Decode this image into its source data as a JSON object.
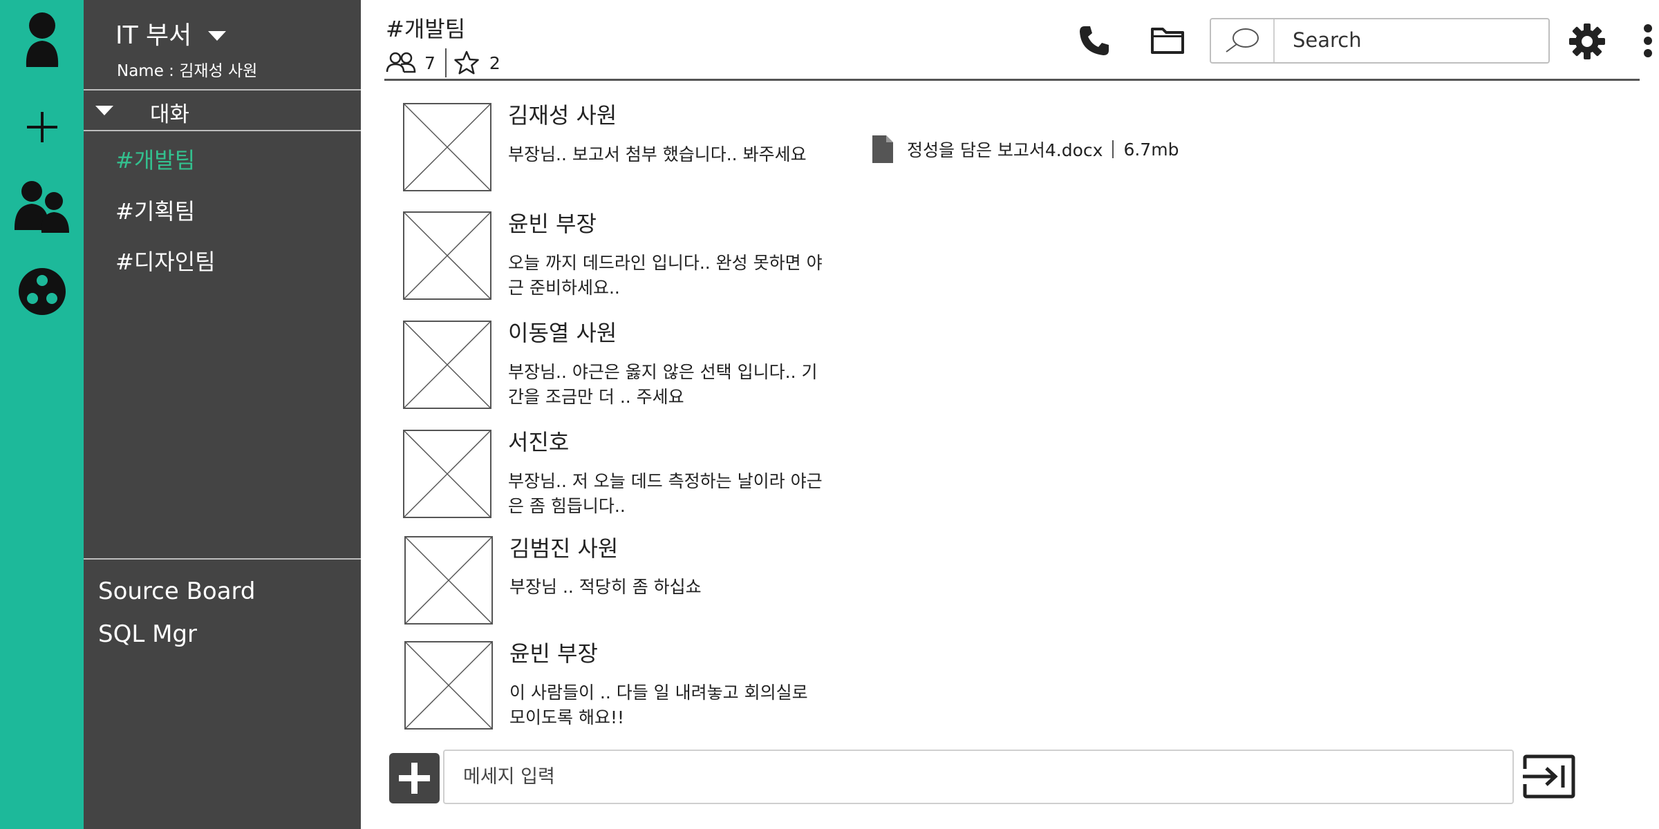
{
  "colors": {
    "rail": "#1db99a",
    "sidebar": "#444444",
    "active_channel": "#33c08e"
  },
  "rail": {
    "icons": [
      "profile-icon",
      "add-icon",
      "users-icon",
      "apps-icon"
    ]
  },
  "sidebar": {
    "workspace": "IT 부서",
    "user": "Name : 김재성 사원",
    "section": "대화",
    "channels": [
      "#개발팀",
      "#기획팀",
      "#디자인팀"
    ],
    "links": [
      "Source Board",
      "SQL Mgr"
    ]
  },
  "header": {
    "title": "#개발팀",
    "members": "7",
    "stars": "2",
    "search_placeholder": "Search",
    "icons": [
      "phone-icon",
      "folder-icon",
      "search-icon",
      "gear-icon",
      "more-icon"
    ]
  },
  "messages": [
    {
      "author": "김재성 사원",
      "text": "부장님.. 보고서 첨부 했습니다.. 봐주세요"
    },
    {
      "author": "윤빈 부장",
      "text": "오늘 까지 데드라인 입니다.. 완성 못하면 야근 준비하세요.."
    },
    {
      "author": "이동열 사원",
      "text": "부장님.. 야근은 옳지 않은 선택 입니다.. 기간을 조금만 더 .. 주세요"
    },
    {
      "author": "서진호",
      "text": "부장님.. 저 오늘 데드 측정하는 날이라 야근은 좀 힘듭니다.."
    },
    {
      "author": "김범진 사원",
      "text": "부장님 .. 적당히 좀 하십쇼"
    },
    {
      "author": "윤빈 부장",
      "text": "이 사람들이 .. 다들 일 내려놓고 회의실로 모이도록 해요!!"
    }
  ],
  "attachment": {
    "filename": "정성을 담은 보고서4.docx",
    "size": "6.7mb",
    "icon": "file-icon"
  },
  "composer": {
    "placeholder": "메세지 입력",
    "icons": [
      "plus-icon",
      "send-icon"
    ]
  }
}
